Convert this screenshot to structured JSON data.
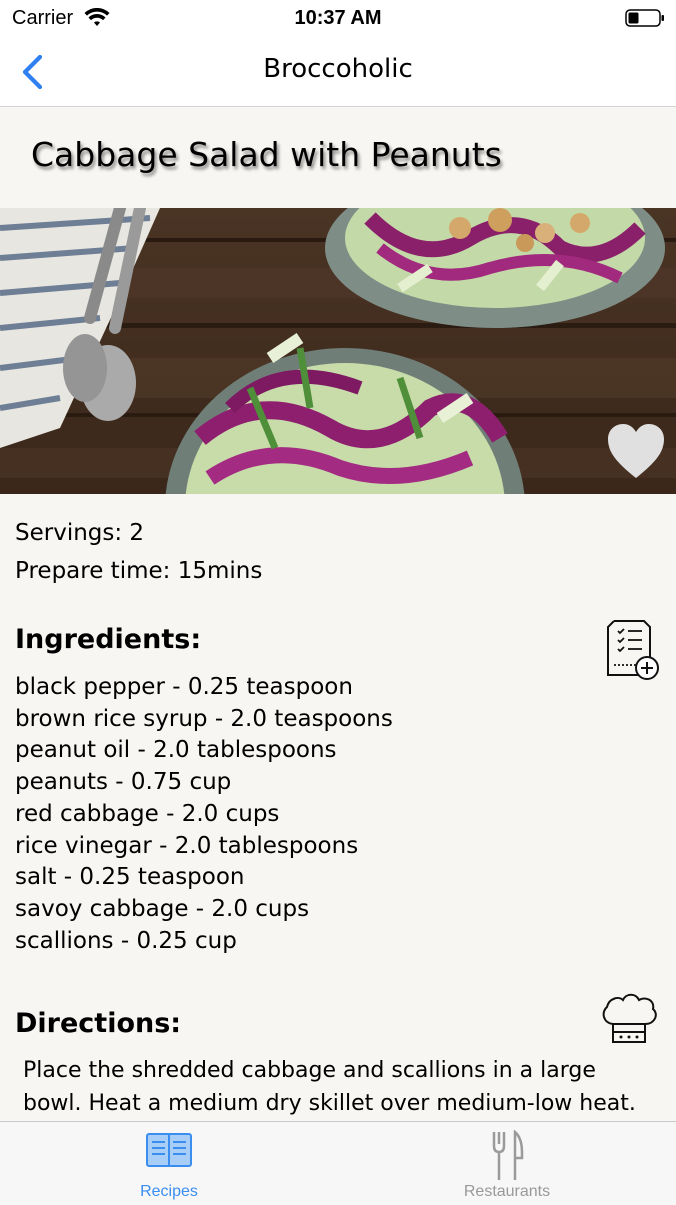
{
  "status_bar": {
    "carrier": "Carrier",
    "time": "10:37 AM"
  },
  "nav": {
    "title": "Broccoholic",
    "back_icon": "chevron-left-icon"
  },
  "recipe": {
    "title": "Cabbage Salad with Peanuts",
    "servings": "Servings: 2",
    "prepare_time": "Prepare time: 15mins",
    "ingredients_heading": "Ingredients:",
    "ingredients": [
      "black pepper - 0.25 teaspoon",
      "brown rice syrup - 2.0 teaspoons",
      "peanut oil - 2.0 tablespoons",
      "peanuts - 0.75 cup",
      "red cabbage - 2.0 cups",
      "rice vinegar - 2.0 tablespoons",
      "salt - 0.25 teaspoon",
      "savoy cabbage - 2.0 cups",
      "scallions - 0.25 cup"
    ],
    "directions_heading": "Directions:",
    "directions_text": "Place the shredded cabbage and scallions in a large bowl. Heat a medium dry skillet over medium-low heat. Add nuts",
    "icons": {
      "favorite": "heart-icon",
      "add_to_list": "shopping-list-add-icon",
      "chef": "chef-hat-icon"
    }
  },
  "tabs": [
    {
      "label": "Recipes",
      "icon": "book-icon",
      "active": true
    },
    {
      "label": "Restaurants",
      "icon": "fork-knife-icon",
      "active": false
    }
  ],
  "colors": {
    "accent": "#3a8ef0",
    "background": "#f8f6f2",
    "inactive_tab": "#999999"
  }
}
